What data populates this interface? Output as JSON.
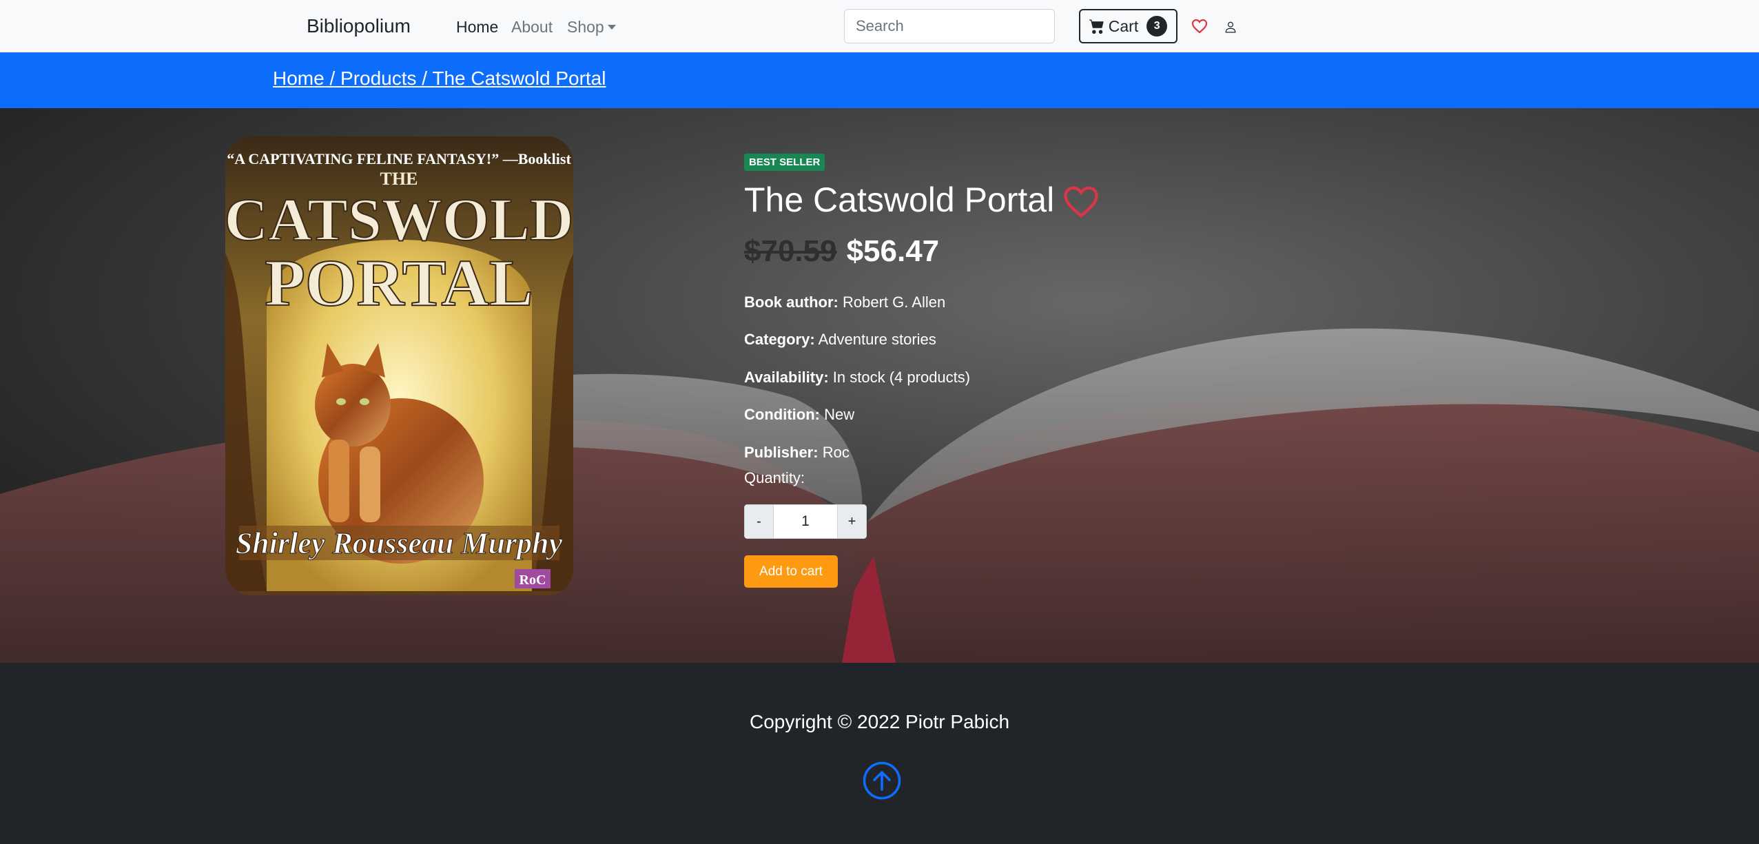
{
  "navbar": {
    "brand": "Bibliopolium",
    "links": [
      {
        "label": "Home"
      },
      {
        "label": "About"
      },
      {
        "label": "Shop"
      }
    ],
    "search_placeholder": "Search",
    "cart_label": "Cart",
    "cart_count": "3"
  },
  "breadcrumb": {
    "text": "Home / Products / The Catswold Portal"
  },
  "product": {
    "badge": "BEST SELLER",
    "title": "The Catswold Portal",
    "old_price": "$70.59",
    "new_price": "$56.47",
    "details": [
      {
        "label": "Book author:",
        "value": "Robert G. Allen"
      },
      {
        "label": "Category:",
        "value": "Adventure stories"
      },
      {
        "label": "Availability:",
        "value": "In stock (4 products)"
      },
      {
        "label": "Condition:",
        "value": "New"
      },
      {
        "label": "Publisher:",
        "value": "Roc"
      }
    ],
    "quantity_label": "Quantity:",
    "minus": "-",
    "quantity": "1",
    "plus": "+",
    "add_to_cart": "Add to cart",
    "cover": {
      "blurb": "“A CAPTIVATING FELINE FANTASY!” —Booklist",
      "title_the": "THE",
      "title_line1": "CATSWOLD",
      "title_line2": "PORTAL",
      "author": "Shirley Rousseau Murphy",
      "imprint": "RoC"
    }
  },
  "footer": {
    "copyright": "Copyright © 2022 Piotr Pabich"
  },
  "colors": {
    "primary": "#0d6efd",
    "success": "#198754",
    "accent_orange": "#fd9a12",
    "heart_red": "#dc3545",
    "dark": "#212529"
  },
  "icons": [
    "cart-icon",
    "heart-icon",
    "user-icon",
    "arrow-up-circle-icon"
  ]
}
